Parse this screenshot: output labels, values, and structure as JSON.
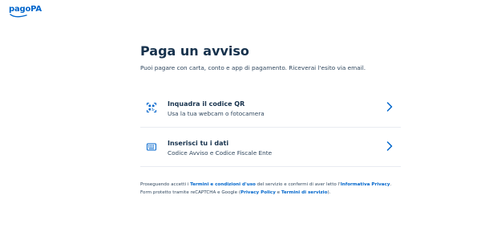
{
  "header": {
    "logo_text": "pagoPA"
  },
  "main": {
    "title": "Paga un avviso",
    "subtitle": "Puoi pagare con carta, conto e app di pagamento. Riceverai l'esito via email."
  },
  "options": [
    {
      "title": "Inquadra il codice QR",
      "description": "Usa la tua webcam o fotocamera",
      "icon": "qr-code-icon"
    },
    {
      "title": "Inserisci tu i dati",
      "description": "Codice Avviso e Codice Fiscale Ente",
      "icon": "keyboard-icon"
    }
  ],
  "footer": {
    "line1_prefix": "Proseguendo accetti i ",
    "terms_link": "Termini e condizioni d'uso",
    "line1_middle": " del servizio e confermi di aver letto l'",
    "privacy_info_link": "Informativa Privacy",
    "line1_suffix": ".",
    "line2_prefix": "Form protetto tramite reCAPTCHA e Google (",
    "privacy_policy_link": "Privacy Policy",
    "line2_and": " e ",
    "terms_service_link": "Termini di servizio",
    "line2_suffix": ")."
  },
  "colors": {
    "brand": "#0066cc",
    "text": "#17324d",
    "divider": "#e8ebf1"
  }
}
